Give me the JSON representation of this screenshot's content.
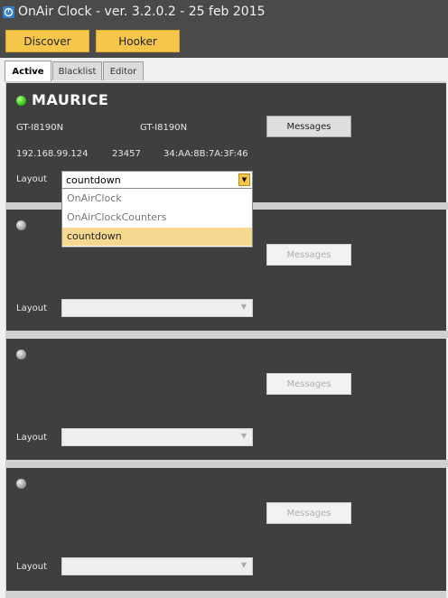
{
  "window": {
    "title": "OnAir Clock - ver. 3.2.0.2 - 25 feb 2015",
    "icon": "app-icon"
  },
  "toolbar": {
    "discover_label": "Discover",
    "hooker_label": "Hooker"
  },
  "tabs": [
    {
      "label": "Active",
      "active": true
    },
    {
      "label": "Blacklist",
      "active": false
    },
    {
      "label": "Editor",
      "active": false
    }
  ],
  "devices": [
    {
      "name": "MAURICE",
      "status": "online",
      "model_a": "GT-I8190N",
      "model_b": "GT-I8190N",
      "ip": "192.168.99.124",
      "port": "23457",
      "mac": "34:AA:8B:7A:3F:46",
      "messages_label": "Messages",
      "layout_label": "Layout",
      "layout_value": "countdown"
    },
    {
      "status": "offline",
      "messages_label": "Messages",
      "layout_label": "Layout",
      "layout_value": ""
    },
    {
      "status": "offline",
      "messages_label": "Messages",
      "layout_label": "Layout",
      "layout_value": ""
    },
    {
      "status": "offline",
      "messages_label": "Messages",
      "layout_label": "Layout",
      "layout_value": ""
    }
  ],
  "layout_dropdown": {
    "options": [
      "OnAirClock",
      "OnAirClockCounters",
      "countdown"
    ],
    "selected": "countdown"
  },
  "colors": {
    "accent": "#f6c64a",
    "panel_bg": "#3f3f3f",
    "status_online": "#34c814",
    "status_offline": "#a0a0a0"
  }
}
